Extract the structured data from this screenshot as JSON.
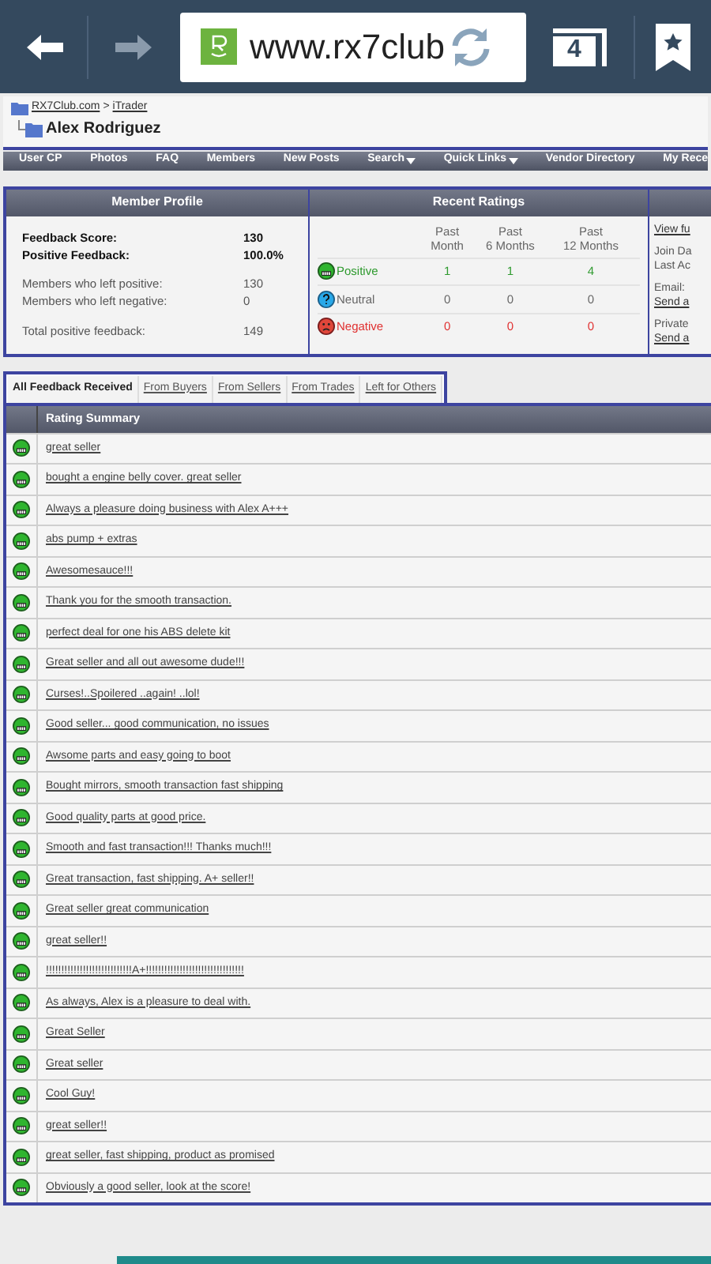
{
  "browser": {
    "url": "www.rx7club",
    "tab_count": "4"
  },
  "breadcrumb": {
    "links": [
      "RX7Club.com",
      "iTrader"
    ],
    "separator": ">",
    "title": "Alex Rodriguez"
  },
  "nav": [
    "User CP",
    "Photos",
    "FAQ",
    "Members",
    "New Posts",
    "Search",
    "Quick Links",
    "Vendor Directory",
    "My Rece"
  ],
  "nav_dropdowns": [
    false,
    false,
    false,
    false,
    false,
    true,
    true,
    false,
    false
  ],
  "member_profile": {
    "heading": "Member Profile",
    "rows": [
      {
        "label": "Feedback Score:",
        "value": "130",
        "bold": true
      },
      {
        "label": "Positive Feedback:",
        "value": "100.0%",
        "bold": true
      },
      {
        "label": "Members who left positive:",
        "value": "130",
        "bold": false
      },
      {
        "label": "Members who left negative:",
        "value": "0",
        "bold": false
      },
      {
        "label": "Total positive feedback:",
        "value": "149",
        "bold": false
      }
    ]
  },
  "recent_ratings": {
    "heading": "Recent Ratings",
    "columns": [
      [
        "Past",
        "Month"
      ],
      [
        "Past",
        "6 Months"
      ],
      [
        "Past",
        "12 Months"
      ]
    ],
    "rows": [
      {
        "kind": "positive",
        "label": "Positive",
        "values": [
          "1",
          "1",
          "4"
        ],
        "color": "#2e9a2e"
      },
      {
        "kind": "neutral",
        "label": "Neutral",
        "values": [
          "0",
          "0",
          "0"
        ],
        "color": "#666666"
      },
      {
        "kind": "negative",
        "label": "Negative",
        "values": [
          "0",
          "0",
          "0"
        ],
        "color": "#e03030"
      }
    ]
  },
  "side_info": [
    {
      "text": "View fu",
      "link": true
    },
    {
      "text": "Join Da",
      "link": false
    },
    {
      "text": "Last Ac",
      "link": false
    },
    {
      "text": "Email:",
      "link": false
    },
    {
      "text": "Send a",
      "link": true
    },
    {
      "text": "Private",
      "link": false
    },
    {
      "text": "Send a",
      "link": true
    }
  ],
  "tabs": [
    {
      "label": "All Feedback Received",
      "selected": true
    },
    {
      "label": "From Buyers",
      "selected": false
    },
    {
      "label": "From Sellers",
      "selected": false
    },
    {
      "label": "From Trades",
      "selected": false
    },
    {
      "label": "Left for Others",
      "selected": false
    }
  ],
  "table": {
    "heading": "Rating Summary",
    "rows": [
      {
        "kind": "positive",
        "text": "great seller"
      },
      {
        "kind": "positive",
        "text": "bought a engine belly cover. great seller"
      },
      {
        "kind": "positive",
        "text": "Always a pleasure doing business with Alex A+++"
      },
      {
        "kind": "positive",
        "text": "abs pump + extras"
      },
      {
        "kind": "positive",
        "text": "Awesomesauce!!!"
      },
      {
        "kind": "positive",
        "text": "Thank you for the smooth transaction."
      },
      {
        "kind": "positive",
        "text": "perfect deal for one his ABS delete kit"
      },
      {
        "kind": "positive",
        "text": "Great seller and all out awesome dude!!!"
      },
      {
        "kind": "positive",
        "text": "Curses!..Spoilered ..again! ..lol!"
      },
      {
        "kind": "positive",
        "text": "Good seller... good communication, no issues"
      },
      {
        "kind": "positive",
        "text": "Awsome parts and easy going to boot"
      },
      {
        "kind": "positive",
        "text": "Bought mirrors, smooth transaction fast shipping"
      },
      {
        "kind": "positive",
        "text": "Good quality parts at good price."
      },
      {
        "kind": "positive",
        "text": "Smooth and fast transaction!!! Thanks much!!!"
      },
      {
        "kind": "positive",
        "text": "Great transaction, fast shipping. A+ seller!!"
      },
      {
        "kind": "positive",
        "text": "Great seller great communication"
      },
      {
        "kind": "positive",
        "text": "great seller!!"
      },
      {
        "kind": "positive",
        "text": "!!!!!!!!!!!!!!!!!!!!!!!!!!!!A+!!!!!!!!!!!!!!!!!!!!!!!!!!!!!!!!"
      },
      {
        "kind": "positive",
        "text": "As always, Alex is a pleasure to deal with."
      },
      {
        "kind": "positive",
        "text": "Great Seller"
      },
      {
        "kind": "positive",
        "text": "Great seller"
      },
      {
        "kind": "positive",
        "text": "Cool Guy!"
      },
      {
        "kind": "positive",
        "text": "great seller!!"
      },
      {
        "kind": "positive",
        "text": "great seller, fast shipping, product as promised"
      },
      {
        "kind": "positive",
        "text": "Obviously a good seller, look at the score!"
      }
    ]
  }
}
